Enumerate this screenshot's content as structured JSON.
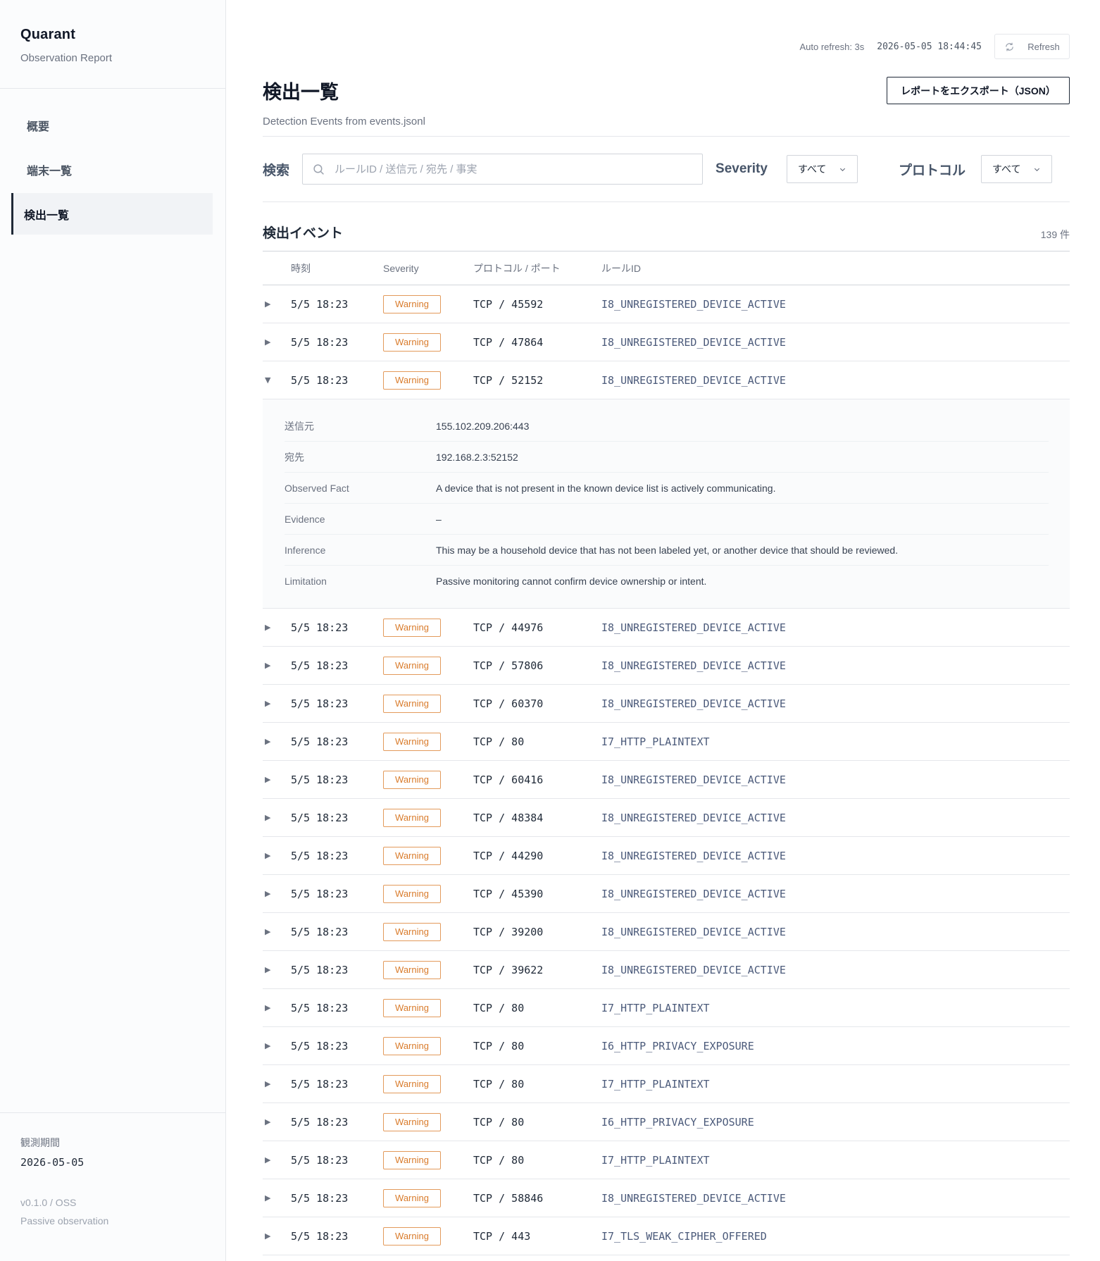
{
  "sidebar": {
    "brand": "Quarant",
    "subtitle": "Observation Report",
    "nav": [
      {
        "label": "概要"
      },
      {
        "label": "端末一覧"
      },
      {
        "label": "検出一覧"
      }
    ],
    "period_label": "観測期間",
    "period_value": "2026-05-05",
    "version": "v0.1.0 / OSS",
    "mode": "Passive observation"
  },
  "topbar": {
    "auto_refresh": "Auto refresh: 3s",
    "timestamp": "2026-05-05 18:44:45",
    "refresh_label": "Refresh"
  },
  "page": {
    "title": "検出一覧",
    "subtitle": "Detection Events from events.jsonl",
    "export_label": "レポートをエクスポート（JSON）"
  },
  "filters": {
    "search_label": "検索",
    "search_placeholder": "ルールID / 送信元 / 宛先 / 事実",
    "severity_label": "Severity",
    "severity_value": "すべて",
    "protocol_label": "プロトコル",
    "protocol_value": "すべて"
  },
  "events": {
    "title": "検出イベント",
    "count": "139 件",
    "columns": {
      "time": "時刻",
      "severity": "Severity",
      "protocol": "プロトコル / ポート",
      "rule": "ルールID"
    },
    "rows_a": [
      {
        "time": "5/5 18:23",
        "severity": "Warning",
        "proto": "TCP / 45592",
        "rule": "I8_UNREGISTERED_DEVICE_ACTIVE"
      },
      {
        "time": "5/5 18:23",
        "severity": "Warning",
        "proto": "TCP / 47864",
        "rule": "I8_UNREGISTERED_DEVICE_ACTIVE"
      },
      {
        "time": "5/5 18:23",
        "severity": "Warning",
        "proto": "TCP / 52152",
        "rule": "I8_UNREGISTERED_DEVICE_ACTIVE"
      }
    ],
    "detail": [
      {
        "key": "送信元",
        "value": "155.102.209.206:443"
      },
      {
        "key": "宛先",
        "value": "192.168.2.3:52152"
      },
      {
        "key": "Observed Fact",
        "value": "A device that is not present in the known device list is actively communicating."
      },
      {
        "key": "Evidence",
        "value": "–"
      },
      {
        "key": "Inference",
        "value": "This may be a household device that has not been labeled yet, or another device that should be reviewed."
      },
      {
        "key": "Limitation",
        "value": "Passive monitoring cannot confirm device ownership or intent."
      }
    ],
    "rows_b": [
      {
        "time": "5/5 18:23",
        "severity": "Warning",
        "proto": "TCP / 44976",
        "rule": "I8_UNREGISTERED_DEVICE_ACTIVE"
      },
      {
        "time": "5/5 18:23",
        "severity": "Warning",
        "proto": "TCP / 57806",
        "rule": "I8_UNREGISTERED_DEVICE_ACTIVE"
      },
      {
        "time": "5/5 18:23",
        "severity": "Warning",
        "proto": "TCP / 60370",
        "rule": "I8_UNREGISTERED_DEVICE_ACTIVE"
      },
      {
        "time": "5/5 18:23",
        "severity": "Warning",
        "proto": "TCP / 80",
        "rule": "I7_HTTP_PLAINTEXT"
      },
      {
        "time": "5/5 18:23",
        "severity": "Warning",
        "proto": "TCP / 60416",
        "rule": "I8_UNREGISTERED_DEVICE_ACTIVE"
      },
      {
        "time": "5/5 18:23",
        "severity": "Warning",
        "proto": "TCP / 48384",
        "rule": "I8_UNREGISTERED_DEVICE_ACTIVE"
      },
      {
        "time": "5/5 18:23",
        "severity": "Warning",
        "proto": "TCP / 44290",
        "rule": "I8_UNREGISTERED_DEVICE_ACTIVE"
      },
      {
        "time": "5/5 18:23",
        "severity": "Warning",
        "proto": "TCP / 45390",
        "rule": "I8_UNREGISTERED_DEVICE_ACTIVE"
      },
      {
        "time": "5/5 18:23",
        "severity": "Warning",
        "proto": "TCP / 39200",
        "rule": "I8_UNREGISTERED_DEVICE_ACTIVE"
      },
      {
        "time": "5/5 18:23",
        "severity": "Warning",
        "proto": "TCP / 39622",
        "rule": "I8_UNREGISTERED_DEVICE_ACTIVE"
      },
      {
        "time": "5/5 18:23",
        "severity": "Warning",
        "proto": "TCP / 80",
        "rule": "I7_HTTP_PLAINTEXT"
      },
      {
        "time": "5/5 18:23",
        "severity": "Warning",
        "proto": "TCP / 80",
        "rule": "I6_HTTP_PRIVACY_EXPOSURE"
      },
      {
        "time": "5/5 18:23",
        "severity": "Warning",
        "proto": "TCP / 80",
        "rule": "I7_HTTP_PLAINTEXT"
      },
      {
        "time": "5/5 18:23",
        "severity": "Warning",
        "proto": "TCP / 80",
        "rule": "I6_HTTP_PRIVACY_EXPOSURE"
      },
      {
        "time": "5/5 18:23",
        "severity": "Warning",
        "proto": "TCP / 80",
        "rule": "I7_HTTP_PLAINTEXT"
      },
      {
        "time": "5/5 18:23",
        "severity": "Warning",
        "proto": "TCP / 58846",
        "rule": "I8_UNREGISTERED_DEVICE_ACTIVE"
      },
      {
        "time": "5/5 18:23",
        "severity": "Warning",
        "proto": "TCP / 443",
        "rule": "I7_TLS_WEAK_CIPHER_OFFERED"
      }
    ]
  },
  "colors": {
    "warning": "#d97b2b",
    "accent": "#1f2937",
    "rule_text": "#4b5a7a"
  },
  "icons": {
    "refresh": "refresh-icon",
    "search": "search-icon",
    "chevron": "chevron-down-icon",
    "caret_collapsed": "caret-right-icon",
    "caret_expanded": "caret-down-icon"
  }
}
